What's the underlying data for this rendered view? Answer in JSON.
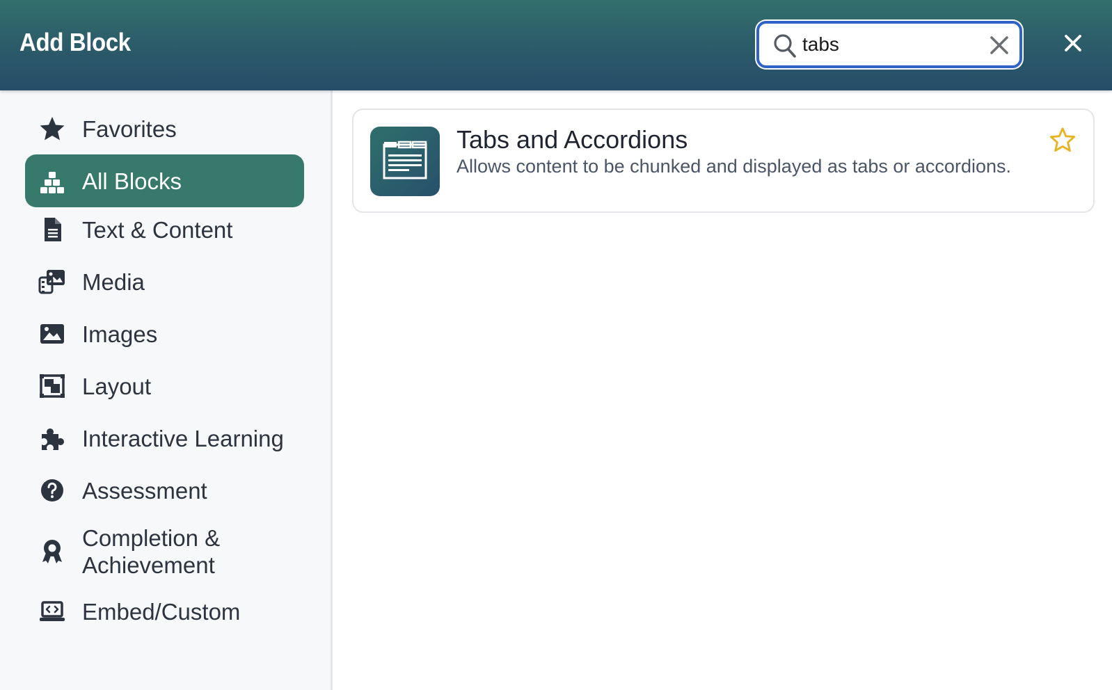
{
  "header": {
    "title": "Add Block",
    "search": {
      "value": "tabs",
      "placeholder": ""
    }
  },
  "sidebar": {
    "items": [
      {
        "label": "Favorites",
        "icon": "star-icon",
        "active": false
      },
      {
        "label": "All Blocks",
        "icon": "blocks-icon",
        "active": true
      },
      {
        "label": "Text & Content",
        "icon": "document-icon",
        "active": false
      },
      {
        "label": "Media",
        "icon": "media-icon",
        "active": false
      },
      {
        "label": "Images",
        "icon": "image-icon",
        "active": false
      },
      {
        "label": "Layout",
        "icon": "layout-icon",
        "active": false
      },
      {
        "label": "Interactive Learning",
        "icon": "puzzle-icon",
        "active": false
      },
      {
        "label": "Assessment",
        "icon": "question-icon",
        "active": false
      },
      {
        "label": "Completion &\nAchievement",
        "icon": "award-icon",
        "active": false
      },
      {
        "label": "Embed/Custom",
        "icon": "embed-icon",
        "active": false
      }
    ]
  },
  "results": [
    {
      "title": "Tabs and Accordions",
      "description": "Allows content to be chunked and displayed as tabs or accordions.",
      "icon": "tabs-window-icon",
      "favorite": false
    }
  ],
  "colors": {
    "header_gradient_start": "#336f6c",
    "header_gradient_end": "#274d69",
    "active_nav": "#377a6c",
    "focus_ring": "#2f63c6",
    "star": "#e6b422",
    "sidebar_text": "#2c3440"
  }
}
